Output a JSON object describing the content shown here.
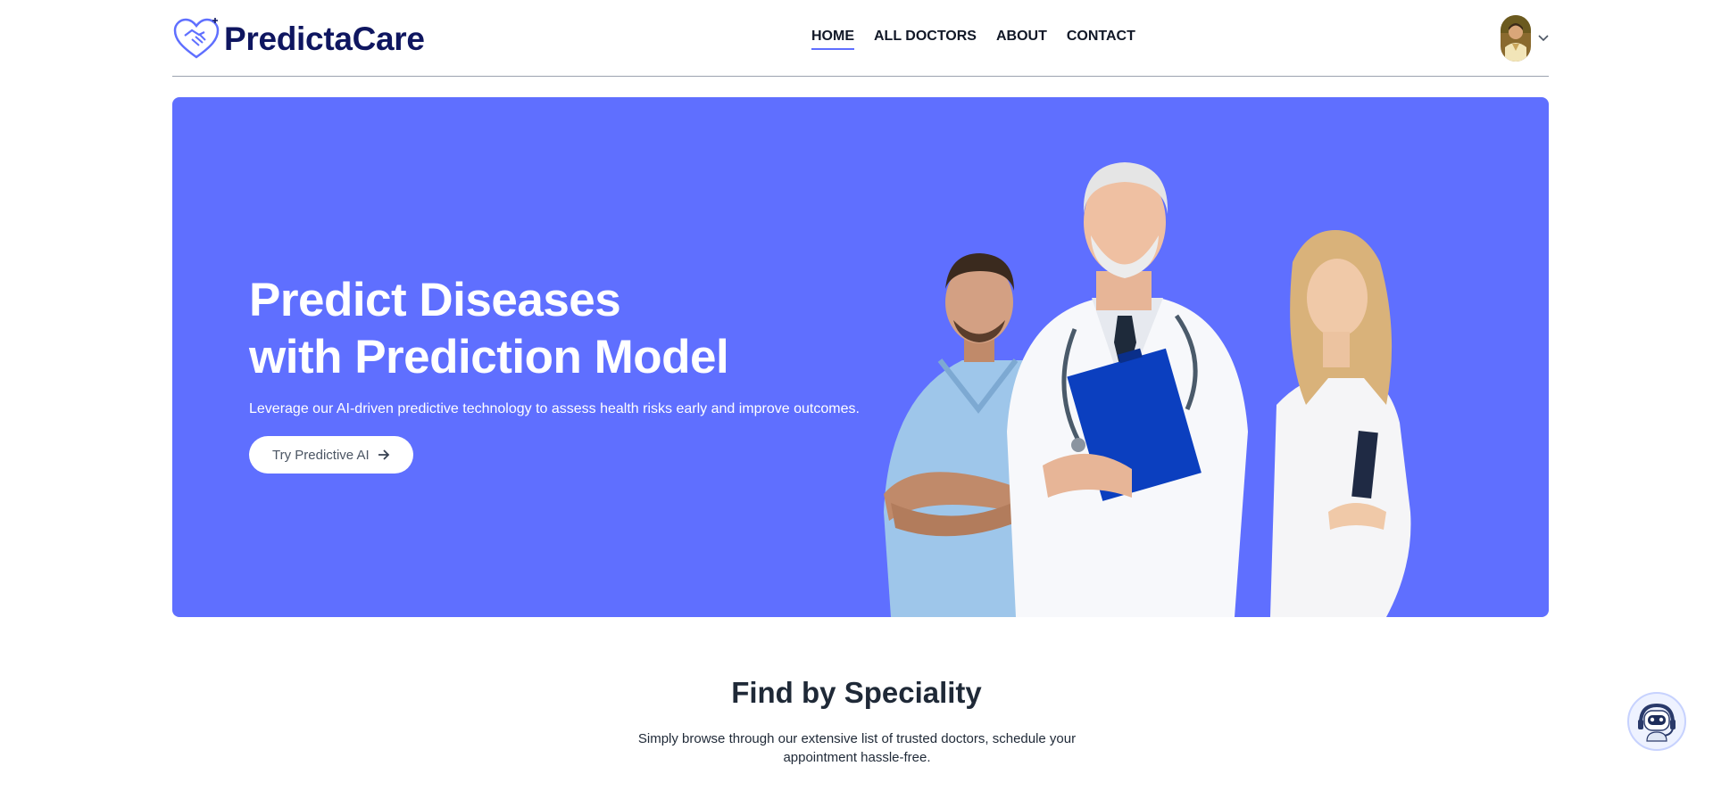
{
  "brand": {
    "name": "PredictaCare",
    "icon": "heart-handshake-icon"
  },
  "nav": {
    "items": [
      {
        "label": "HOME",
        "active": true
      },
      {
        "label": "ALL DOCTORS",
        "active": false
      },
      {
        "label": "ABOUT",
        "active": false
      },
      {
        "label": "CONTACT",
        "active": false
      }
    ]
  },
  "profile": {
    "icon": "chevron-down-icon"
  },
  "hero": {
    "title_line1": "Predict Diseases",
    "title_line2": "with Prediction Model",
    "subtitle": "Leverage our AI-driven predictive technology to assess health risks early and improve outcomes.",
    "button_label": "Try Predictive AI",
    "button_icon": "arrow-right-icon"
  },
  "speciality": {
    "title": "Find by Speciality",
    "description": "Simply browse through our extensive list of trusted doctors, schedule your appointment hassle-free."
  },
  "chatbot": {
    "icon": "robot-icon"
  },
  "colors": {
    "primary": "#5f6fff",
    "brand_dark": "#0f1660",
    "text": "#1f2937"
  }
}
